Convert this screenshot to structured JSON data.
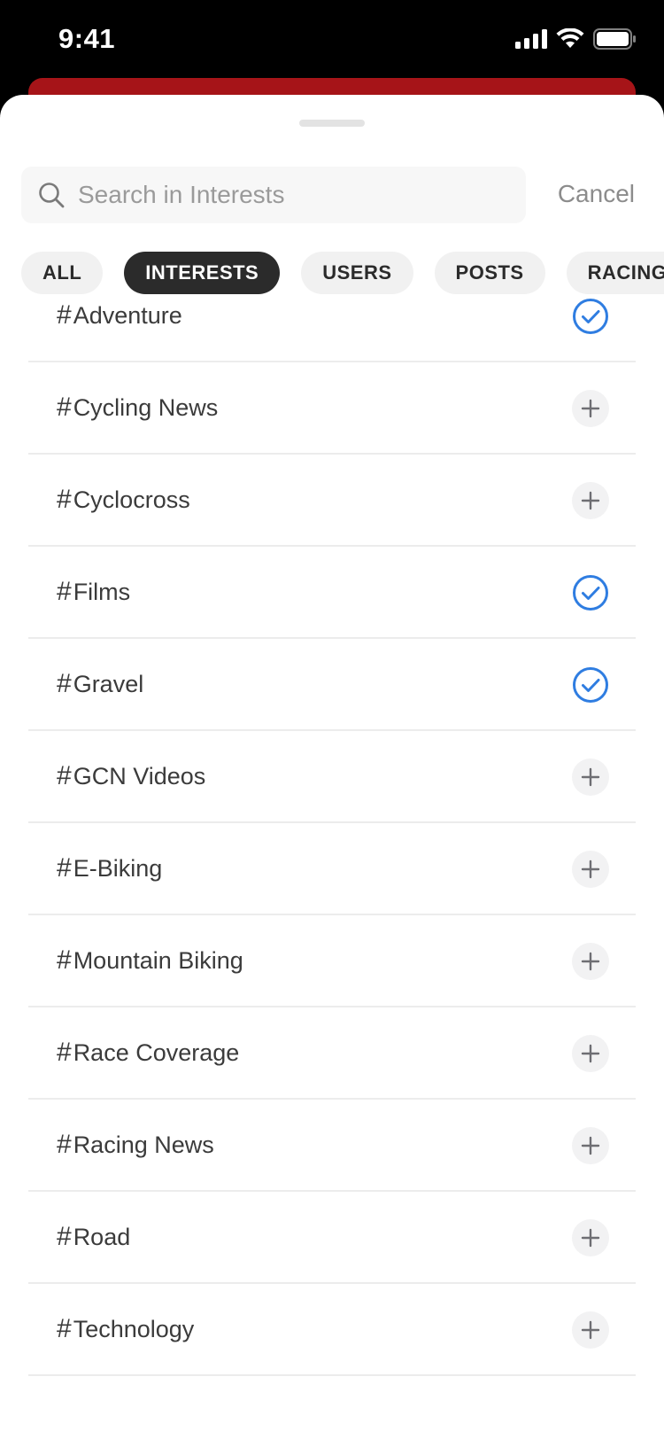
{
  "status_bar": {
    "time": "9:41"
  },
  "search": {
    "placeholder": "Search in Interests",
    "value": "",
    "cancel_label": "Cancel"
  },
  "tabs": [
    {
      "label": "ALL",
      "active": false
    },
    {
      "label": "INTERESTS",
      "active": true
    },
    {
      "label": "USERS",
      "active": false
    },
    {
      "label": "POSTS",
      "active": false
    },
    {
      "label": "RACING",
      "active": false
    }
  ],
  "interests": [
    {
      "hash": "#",
      "name": "Adventure",
      "followed": true,
      "icon": "check-circle-icon"
    },
    {
      "hash": "#",
      "name": "Cycling News",
      "followed": false,
      "icon": "plus-icon"
    },
    {
      "hash": "#",
      "name": "Cyclocross",
      "followed": false,
      "icon": "plus-icon"
    },
    {
      "hash": "#",
      "name": "Films",
      "followed": true,
      "icon": "check-circle-icon"
    },
    {
      "hash": "#",
      "name": "Gravel",
      "followed": true,
      "icon": "check-circle-icon"
    },
    {
      "hash": "#",
      "name": "GCN Videos",
      "followed": false,
      "icon": "plus-icon"
    },
    {
      "hash": "#",
      "name": "E-Biking",
      "followed": false,
      "icon": "plus-icon"
    },
    {
      "hash": "#",
      "name": "Mountain Biking",
      "followed": false,
      "icon": "plus-icon"
    },
    {
      "hash": "#",
      "name": "Race Coverage",
      "followed": false,
      "icon": "plus-icon"
    },
    {
      "hash": "#",
      "name": "Racing News",
      "followed": false,
      "icon": "plus-icon"
    },
    {
      "hash": "#",
      "name": "Road",
      "followed": false,
      "icon": "plus-icon"
    },
    {
      "hash": "#",
      "name": "Technology",
      "followed": false,
      "icon": "plus-icon"
    }
  ],
  "colors": {
    "accent_blue": "#2f7de1",
    "brand_red": "#a61418",
    "active_chip": "#2b2b2b",
    "plus_gray": "#6e6e73"
  }
}
